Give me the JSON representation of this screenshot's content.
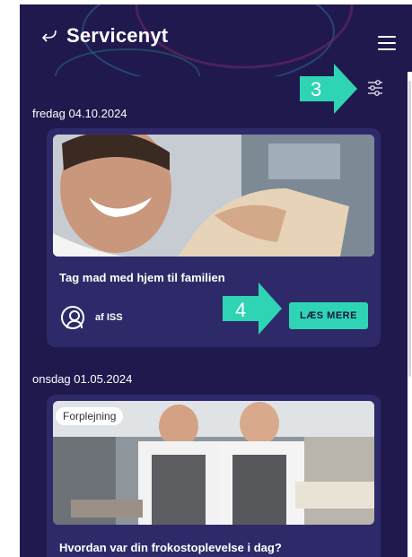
{
  "app": {
    "title": "Servicenyt",
    "accent": "#2fd4b4",
    "background": "#20194e",
    "card_background": "#2e2a69"
  },
  "header": {
    "back_icon": "back-arrow-icon",
    "menu_icon": "hamburger-menu-icon",
    "filter_icon": "filter-sliders-icon"
  },
  "callouts": {
    "filter": "3",
    "read_more": "4"
  },
  "news": [
    {
      "date": "fredag 04.10.2024",
      "title": "Tag mad med hjem til familien",
      "author": "af ISS",
      "button": "LÆS MERE"
    },
    {
      "date": "onsdag 01.05.2024",
      "tag": "Forplejning",
      "title": "Hvordan var din frokostoplevelse i dag?"
    }
  ]
}
